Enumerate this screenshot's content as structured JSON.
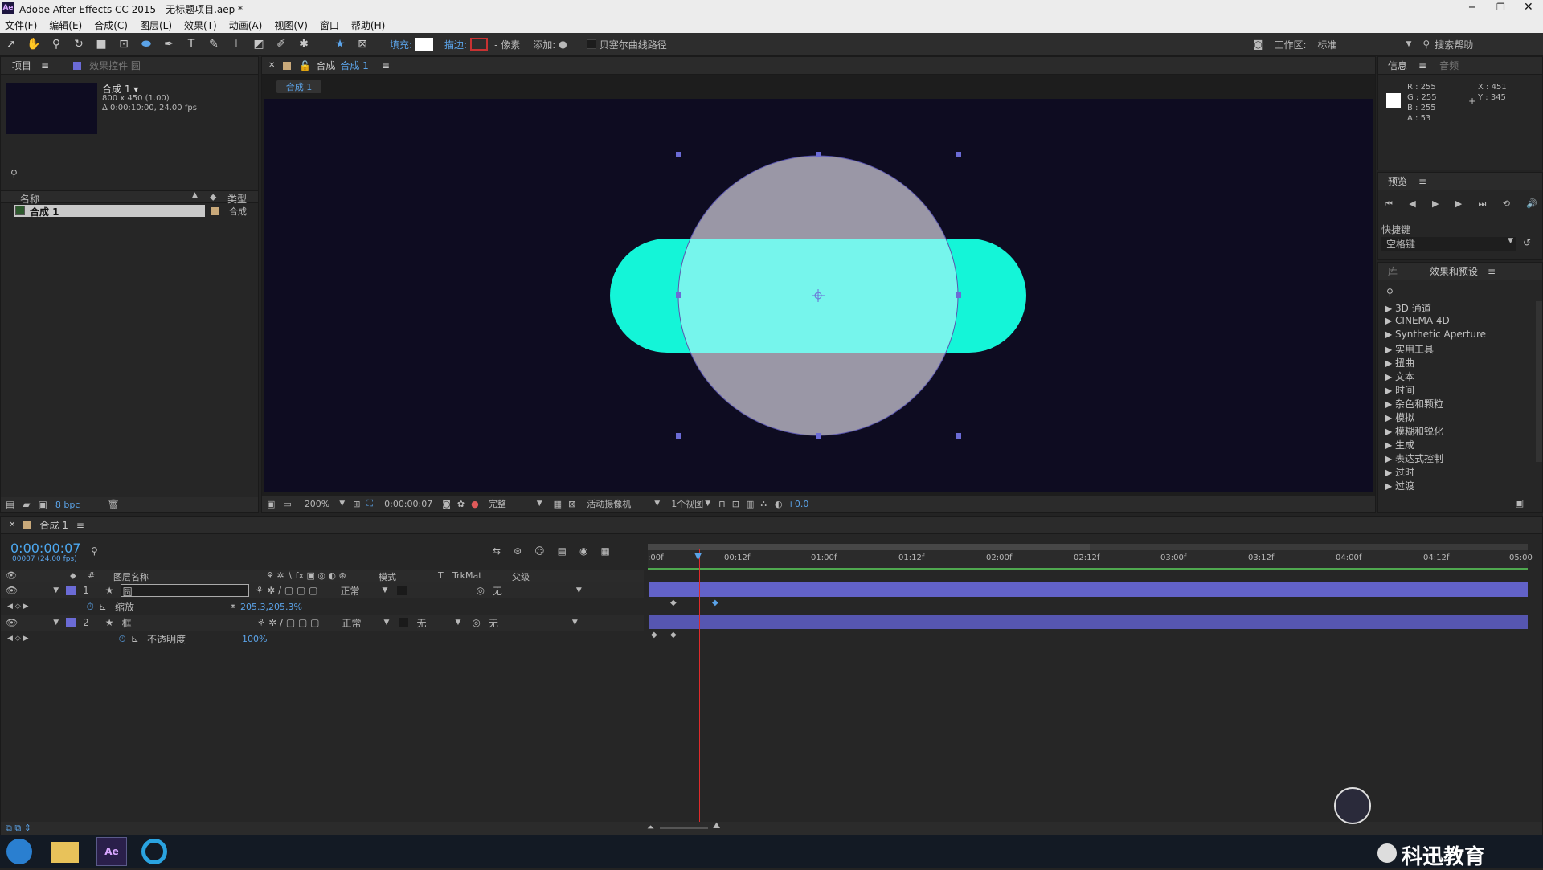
{
  "app": {
    "title": "Adobe After Effects CC 2015 - 无标题项目.aep *"
  },
  "window_controls": {
    "minimize": "─",
    "maximize": "❐",
    "close": "✕"
  },
  "menu": [
    "文件(F)",
    "编辑(E)",
    "合成(C)",
    "图层(L)",
    "效果(T)",
    "动画(A)",
    "视图(V)",
    "窗口",
    "帮助(H)"
  ],
  "toolbar": {
    "fill_label": "填充:",
    "stroke_label": "描边:",
    "stroke_width": "- 像素",
    "add_label": "添加:",
    "bezier_label": "贝塞尔曲线路径",
    "workspace_label": "工作区:",
    "workspace_value": "标准",
    "search_help": "搜索帮助"
  },
  "project_panel": {
    "tab_project": "项目",
    "tab_effects": "效果控件 圆",
    "comp_name": "合成 1 ▾",
    "comp_size": "800 x 450 (1.00)",
    "comp_duration": "Δ 0:00:10:00, 24.00 fps",
    "col_name": "名称",
    "col_type": "类型",
    "item_name": "合成 1",
    "item_type": "合成",
    "bpc": "8 bpc"
  },
  "comp_viewer": {
    "tab_title": "合成",
    "tab_comp": "合成 1",
    "sub_tab": "合成 1",
    "zoom": "200%",
    "timecode": "0:00:00:07",
    "quality": "完整",
    "camera": "活动摄像机",
    "views": "1个视图",
    "exposure": "+0.0"
  },
  "info_panel": {
    "tab_info": "信息",
    "tab_audio": "音频",
    "r": "R : 255",
    "g": "G : 255",
    "b": "B : 255",
    "a": "A : 53",
    "x": "X : 451",
    "y": "Y : 345"
  },
  "preview_panel": {
    "title": "预览",
    "shortcut_label": "快捷键",
    "shortcut_value": "空格键"
  },
  "effects_panel": {
    "tab_library": "库",
    "tab_effects": "效果和预设",
    "items": [
      "3D 通道",
      "CINEMA 4D",
      "Synthetic Aperture",
      "实用工具",
      "扭曲",
      "文本",
      "时间",
      "杂色和颗粒",
      "模拟",
      "模糊和锐化",
      "生成",
      "表达式控制",
      "过时",
      "过渡"
    ]
  },
  "timeline": {
    "comp_tab": "合成 1",
    "current_time": "0:00:00:07",
    "frame_info": "00007 (24.00 fps)",
    "col_layer_name": "图层名称",
    "col_mode": "模式",
    "col_t": "T",
    "col_trkmat": "TrkMat",
    "col_parent": "父级",
    "ticks": [
      ":00f",
      "00:12f",
      "01:00f",
      "01:12f",
      "02:00f",
      "02:12f",
      "03:00f",
      "03:12f",
      "04:00f",
      "04:12f",
      "05:00"
    ],
    "layers": [
      {
        "num": "1",
        "name": "圆",
        "mode": "正常",
        "parent": "无",
        "trkmat": ""
      },
      {
        "num": "2",
        "name": "框",
        "mode": "正常",
        "parent": "无",
        "trkmat": "无"
      }
    ],
    "prop1_name": "缩放",
    "prop1_value": "205.3,205.3%",
    "prop2_name": "不透明度",
    "prop2_value": "100%"
  },
  "colors": {
    "teal": "#14f5d8",
    "circle": "#9a97a6",
    "overlap": "#76f5ec",
    "comp_bg": "#0e0c21",
    "layer_bar": "#6262c8",
    "accent_blue": "#5ba3e8"
  },
  "watermark": {
    "text": "科迅教育"
  }
}
